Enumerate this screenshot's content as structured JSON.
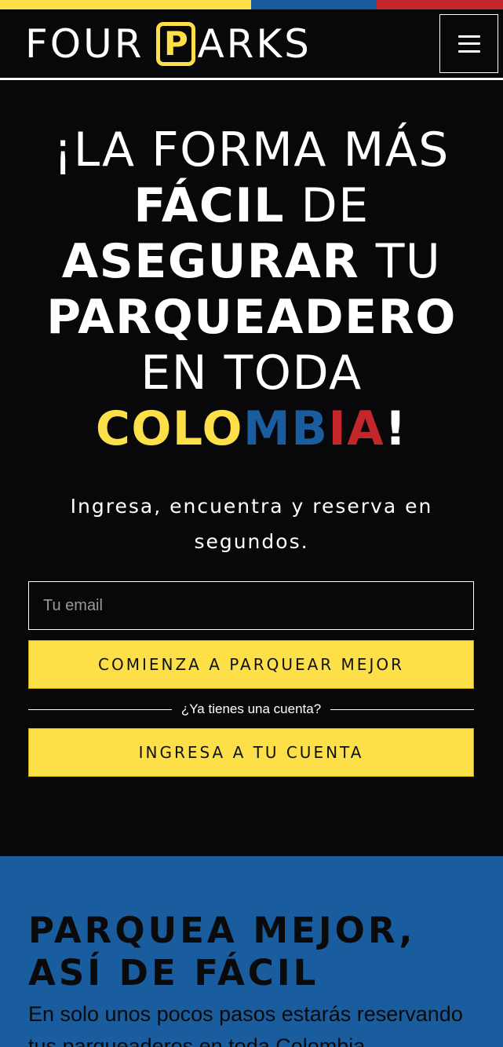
{
  "colors": {
    "yellow": "#fde047",
    "blue": "#1a5d9e",
    "red": "#c3262b",
    "background": "#08080a"
  },
  "header": {
    "logo_word1": "FOUR",
    "logo_p": "P",
    "logo_word2": "ARKS",
    "menu_icon": "hamburger-menu-icon"
  },
  "hero": {
    "headline": {
      "l1": "¡LA FORMA MÁS",
      "l2_bold": "FÁCIL",
      "l2_light": " DE",
      "l3_bold": "ASEGURAR",
      "l3_light": " TU",
      "l4_bold": "PARQUEADERO",
      "l5": "EN TODA",
      "l6_yellow": "COLO",
      "l6_blue": "MB",
      "l6_red": "IA",
      "l6_end": "!"
    },
    "subtitle": "Ingresa, encuentra y reserva en segundos.",
    "email_placeholder": "Tu email",
    "start_button": "COMIENZA A PARQUEAR MEJOR",
    "divider_text": "¿Ya tienes una cuenta?",
    "login_button": "INGRESA A TU CUENTA"
  },
  "steps": {
    "title": "PARQUEA MEJOR, ASÍ DE FÁCIL",
    "text": "En solo unos pocos pasos estarás reservando tus parqueaderos en toda Colombia."
  }
}
